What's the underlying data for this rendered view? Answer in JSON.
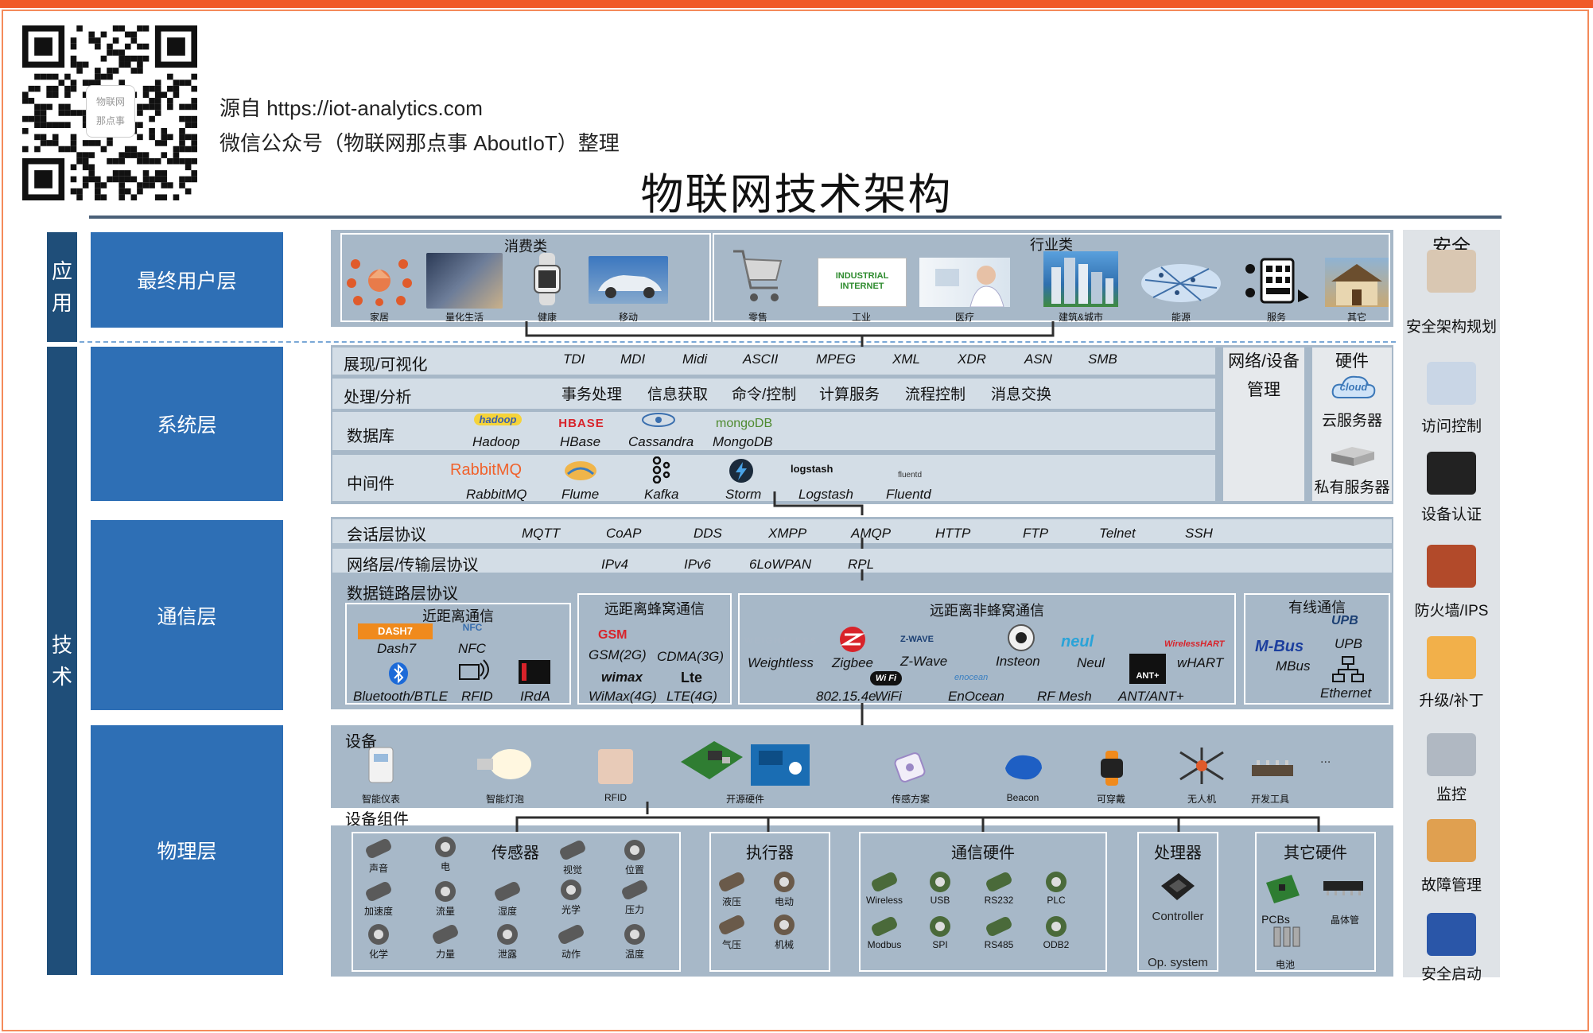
{
  "header": {
    "source_line": "源自 https://iot-analytics.com",
    "wechat_line": "微信公众号（物联网那点事 AboutIoT）整理",
    "qr_text_1": "物联网",
    "qr_text_2": "那点事",
    "title": "物联网技术架构"
  },
  "side_bars": {
    "application": [
      "应",
      "用"
    ],
    "technology": [
      "技",
      "术"
    ]
  },
  "layers": {
    "end_user": "最终用户层",
    "system": "系统层",
    "communication": "通信层",
    "physical": "物理层"
  },
  "end_user": {
    "consumer_header": "消费类",
    "industry_header": "行业类",
    "consumer_items": [
      "家居",
      "量化生活",
      "健康",
      "移动"
    ],
    "industry_items": [
      "零售",
      "工业",
      "医疗",
      "建筑&城市",
      "能源",
      "服务",
      "其它"
    ],
    "industrial_internet_sign": "INDUSTRIAL INTERNET"
  },
  "system": {
    "rows": [
      {
        "label": "展现/可视化",
        "items": [
          "TDI",
          "MDI",
          "Midi",
          "ASCII",
          "MPEG",
          "XML",
          "XDR",
          "ASN",
          "SMB"
        ]
      },
      {
        "label": "处理/分析",
        "items": [
          "事务处理",
          "信息获取",
          "命令/控制",
          "计算服务",
          "流程控制",
          "消息交换"
        ]
      },
      {
        "label": "数据库",
        "items": [
          "Hadoop",
          "HBase",
          "Cassandra",
          "MongoDB"
        ]
      },
      {
        "label": "中间件",
        "items": [
          "RabbitMQ",
          "Flume",
          "Kafka",
          "Storm",
          "Logstash",
          "Fluentd"
        ]
      }
    ],
    "logos": {
      "hadoop": "hadoop",
      "hbase": "HBASE",
      "cassandra": "cassandra",
      "mongodb": "mongoDB",
      "rabbitmq": "RabbitMQ",
      "logstash": "logstash",
      "fluentd": "fluentd"
    },
    "network_mgmt": [
      "网络/设备",
      "管理"
    ],
    "hardware": {
      "header": "硬件",
      "cloud_logo": "cloud",
      "items": [
        "云服务器",
        "私有服务器"
      ]
    }
  },
  "communication": {
    "session": {
      "label": "会话层协议",
      "items": [
        "MQTT",
        "CoAP",
        "DDS",
        "XMPP",
        "AMQP",
        "HTTP",
        "FTP",
        "Telnet",
        "SSH"
      ]
    },
    "network": {
      "label": "网络层/传输层协议",
      "items": [
        "IPv4",
        "IPv6",
        "6LoWPAN",
        "RPL"
      ]
    },
    "datalink": {
      "label": "数据链路层协议",
      "short_range": {
        "header": "近距离通信",
        "items": [
          "Dash7",
          "NFC",
          "Bluetooth/BTLE",
          "RFID",
          "IRdA"
        ],
        "logo_dash7": "DASH7",
        "logo_nfc": "NFC"
      },
      "long_cellular": {
        "header": "远距离蜂窝通信",
        "items": [
          "GSM(2G)",
          "CDMA(3G)",
          "WiMax(4G)",
          "LTE(4G)"
        ],
        "logo_gsm": "GSM",
        "logo_wimax": "wimax",
        "logo_lte": "Lte"
      },
      "long_noncellular": {
        "header": "远距离非蜂窝通信",
        "items": [
          "Weightless",
          "Zigbee",
          "Z-Wave",
          "Insteon",
          "Neul",
          "wHART",
          "802.15.4e",
          "WiFi",
          "EnOcean",
          "RF Mesh",
          "ANT/ANT+"
        ],
        "logo_weightless": "WEIGHTLESS",
        "logo_zwave": "Z-WAVE",
        "logo_neul": "neul",
        "logo_whart": "WirelessHART",
        "logo_wifi": "Wi Fi",
        "logo_enocean": "enocean",
        "logo_ant": "ANT+"
      },
      "wired": {
        "header": "有线通信",
        "items": [
          "UPB",
          "MBus",
          "Ethernet"
        ],
        "logo_upb": "UPB",
        "logo_mbus": "M-Bus"
      }
    }
  },
  "physical": {
    "devices_label": "设备",
    "devices": [
      "智能仪表",
      "智能灯泡",
      "RFID",
      "开源硬件",
      "传感方案",
      "Beacon",
      "可穿戴",
      "无人机",
      "开发工具"
    ],
    "devices_more": "...",
    "components_label": "设备组件",
    "sensors": {
      "header": "传感器",
      "items": [
        "声音",
        "电",
        "视觉",
        "位置",
        "加速度",
        "流量",
        "湿度",
        "光学",
        "压力",
        "化学",
        "力量",
        "泄露",
        "动作",
        "温度"
      ]
    },
    "actuators": {
      "header": "执行器",
      "items": [
        "液压",
        "电动",
        "气压",
        "机械"
      ]
    },
    "comm_hw": {
      "header": "通信硬件",
      "items": [
        "Wireless",
        "USB",
        "RS232",
        "PLC",
        "Modbus",
        "SPI",
        "RS485",
        "ODB2"
      ]
    },
    "processor": {
      "header": "处理器",
      "items": [
        "Controller",
        "Op. system"
      ]
    },
    "other_hw": {
      "header": "其它硬件",
      "items": [
        "PCBs",
        "晶体管",
        "电池"
      ]
    }
  },
  "security": {
    "header": "安全",
    "items": [
      "安全架构规划",
      "访问控制",
      "设备认证",
      "防火墙/IPS",
      "升级/补丁",
      "监控",
      "故障管理",
      "安全启动"
    ]
  },
  "colors": {
    "accent_orange": "#f05a28",
    "layer_blue": "#2e6fb5",
    "side_navy": "#1f4e79",
    "panel_gray": "#a7b8c8",
    "row_light": "#d3dde6"
  }
}
